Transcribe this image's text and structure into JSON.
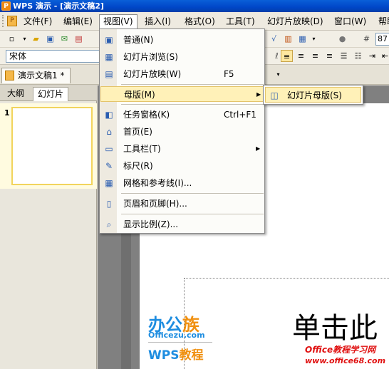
{
  "window": {
    "title": "WPS 演示 - [演示文稿2]"
  },
  "menubar": {
    "items": [
      {
        "label": "文件(F)",
        "name": "menu-file"
      },
      {
        "label": "编辑(E)",
        "name": "menu-edit"
      },
      {
        "label": "视图(V)",
        "name": "menu-view"
      },
      {
        "label": "插入(I)",
        "name": "menu-insert"
      },
      {
        "label": "格式(O)",
        "name": "menu-format"
      },
      {
        "label": "工具(T)",
        "name": "menu-tools"
      },
      {
        "label": "幻灯片放映(D)",
        "name": "menu-slideshow"
      },
      {
        "label": "窗口(W)",
        "name": "menu-window"
      },
      {
        "label": "帮助",
        "name": "menu-help"
      }
    ]
  },
  "toolbar": {
    "font_name": "宋体",
    "font_size": "87"
  },
  "doc_tabs": {
    "active_label": "演示文稿1 *"
  },
  "left_pane": {
    "tabs": [
      "大纲",
      "幻灯片"
    ],
    "slide_number": "1"
  },
  "view_menu": {
    "items": [
      {
        "label": "普通(N)",
        "shortcut": "",
        "icon": "normal-view-icon"
      },
      {
        "label": "幻灯片浏览(S)",
        "shortcut": "",
        "icon": "slide-sorter-icon"
      },
      {
        "label": "幻灯片放映(W)",
        "shortcut": "F5",
        "icon": "slideshow-icon"
      },
      {
        "label": "母版(M)",
        "shortcut": "",
        "icon": "",
        "submenu": true
      },
      {
        "label": "任务窗格(K)",
        "shortcut": "Ctrl+F1",
        "icon": "task-pane-icon"
      },
      {
        "label": "首页(E)",
        "shortcut": "",
        "icon": "home-icon"
      },
      {
        "label": "工具栏(T)",
        "shortcut": "",
        "icon": "toolbar-icon",
        "submenu": true
      },
      {
        "label": "标尺(R)",
        "shortcut": "",
        "icon": "ruler-icon"
      },
      {
        "label": "网格和参考线(I)...",
        "shortcut": "",
        "icon": "grid-icon"
      },
      {
        "label": "页眉和页脚(H)...",
        "shortcut": "",
        "icon": "header-footer-icon"
      },
      {
        "label": "显示比例(Z)...",
        "shortcut": "",
        "icon": "zoom-icon"
      }
    ]
  },
  "submenu": {
    "label": "幻灯片母版(S)"
  },
  "slide": {
    "title_text": "单击此"
  },
  "watermarks": {
    "logo_main": "办公",
    "logo_accent": "族",
    "logo_url": "Officezu.com",
    "tutorial_main": "WPS",
    "tutorial_accent": "教程",
    "site_name": "Office教程学习网",
    "site_url": "www.office68.com"
  },
  "colors": {
    "title_bar": "#0046c8",
    "menu_highlight": "#fff1b8",
    "thumb_border": "#f2d45c",
    "watermark_blue": "#1e8de0",
    "watermark_orange": "#f09010",
    "watermark_red": "#e01010"
  }
}
